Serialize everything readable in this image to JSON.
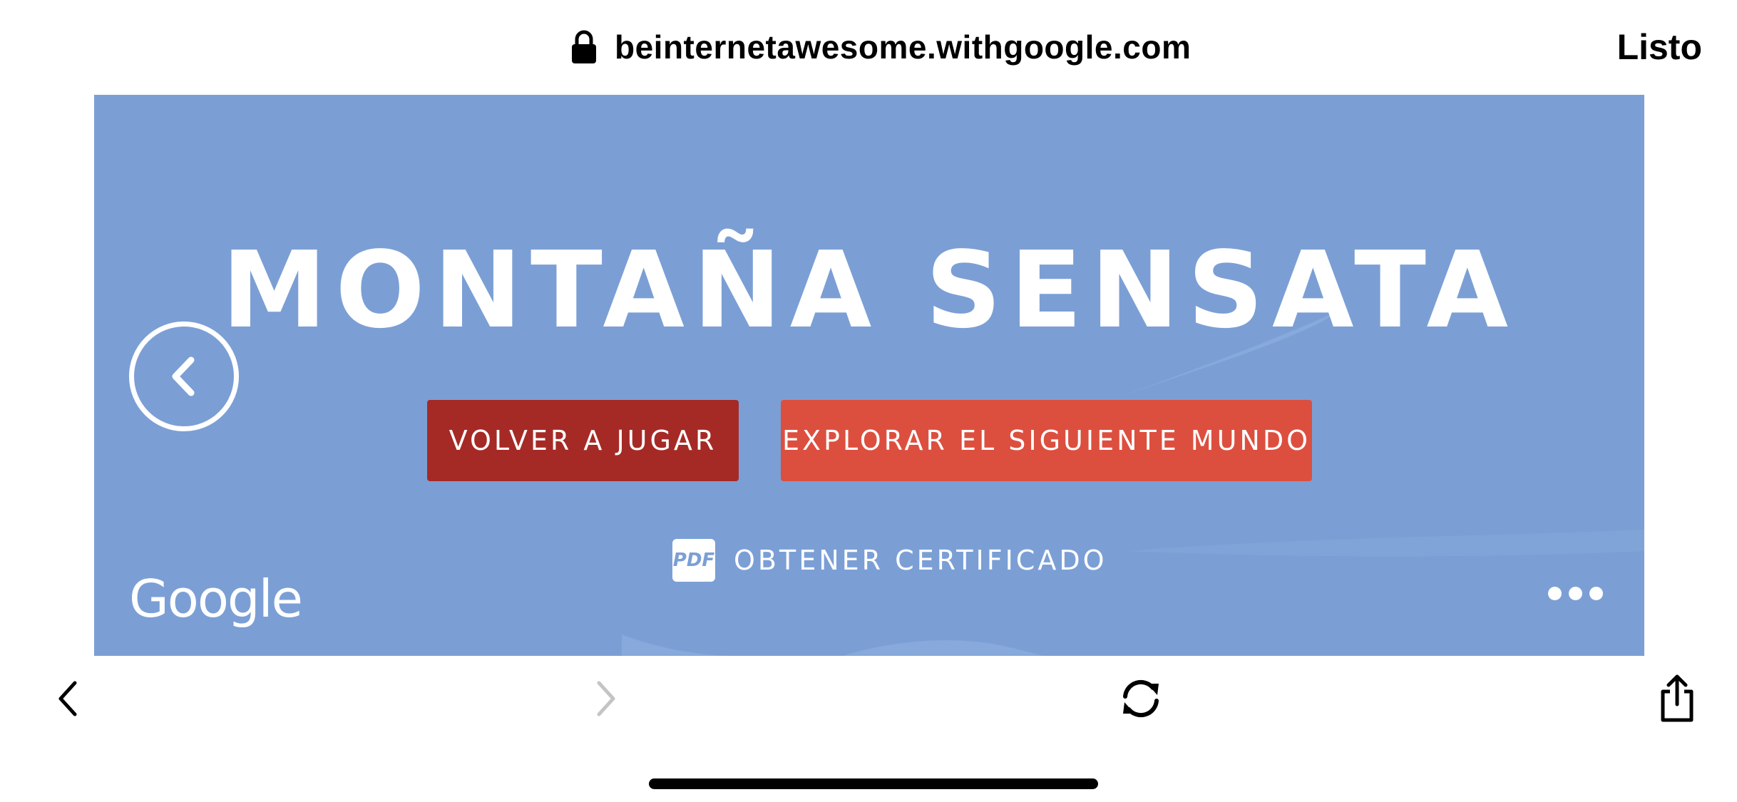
{
  "browser": {
    "url": "beinternetawesome.withgoogle.com",
    "done_label": "Listo"
  },
  "game": {
    "title": "MONTAÑA SENSATA",
    "replay_label": "VOLVER A JUGAR",
    "next_world_label": "EXPLORAR EL SIGUIENTE MUNDO",
    "pdf_badge": "PDF",
    "certificate_label": "OBTENER CERTIFICADO",
    "brand": "Google",
    "background_color": "#7b9fd5",
    "replay_color": "#a52a26",
    "next_color": "#dc4f3f"
  },
  "toolbar": {
    "back_icon": "chevron-left-icon",
    "forward_icon": "chevron-right-icon",
    "reload_icon": "reload-icon",
    "share_icon": "share-icon"
  }
}
